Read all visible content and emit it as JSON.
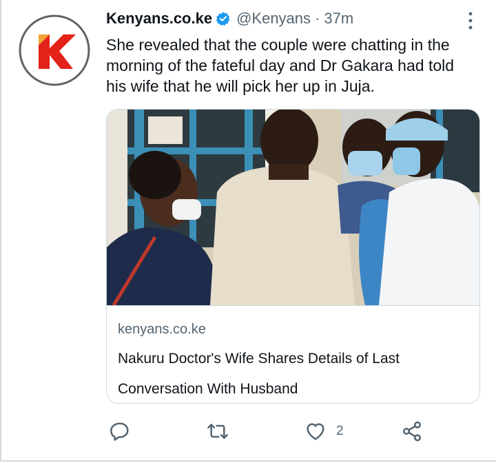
{
  "tweet": {
    "author_name": "Kenyans.co.ke",
    "handle": "@Kenyans",
    "separator": "·",
    "time": "37m",
    "text": "She revealed that the couple were chatting in the morning of the fateful day and Dr Gakara had told his wife that he will pick her up in Juja."
  },
  "card": {
    "domain": "kenyans.co.ke",
    "title": "Nakuru Doctor's Wife Shares Details of Last Conversation With Husband"
  },
  "actions": {
    "reply_icon": "reply-icon",
    "retweet_icon": "retweet-icon",
    "like_icon": "heart-icon",
    "like_count": "2",
    "share_icon": "share-icon"
  },
  "colors": {
    "brand_red": "#e32219",
    "verified_blue": "#1d9bf0",
    "secondary_text": "#536471",
    "icon_gray": "#536471",
    "border": "#cfd9de"
  }
}
